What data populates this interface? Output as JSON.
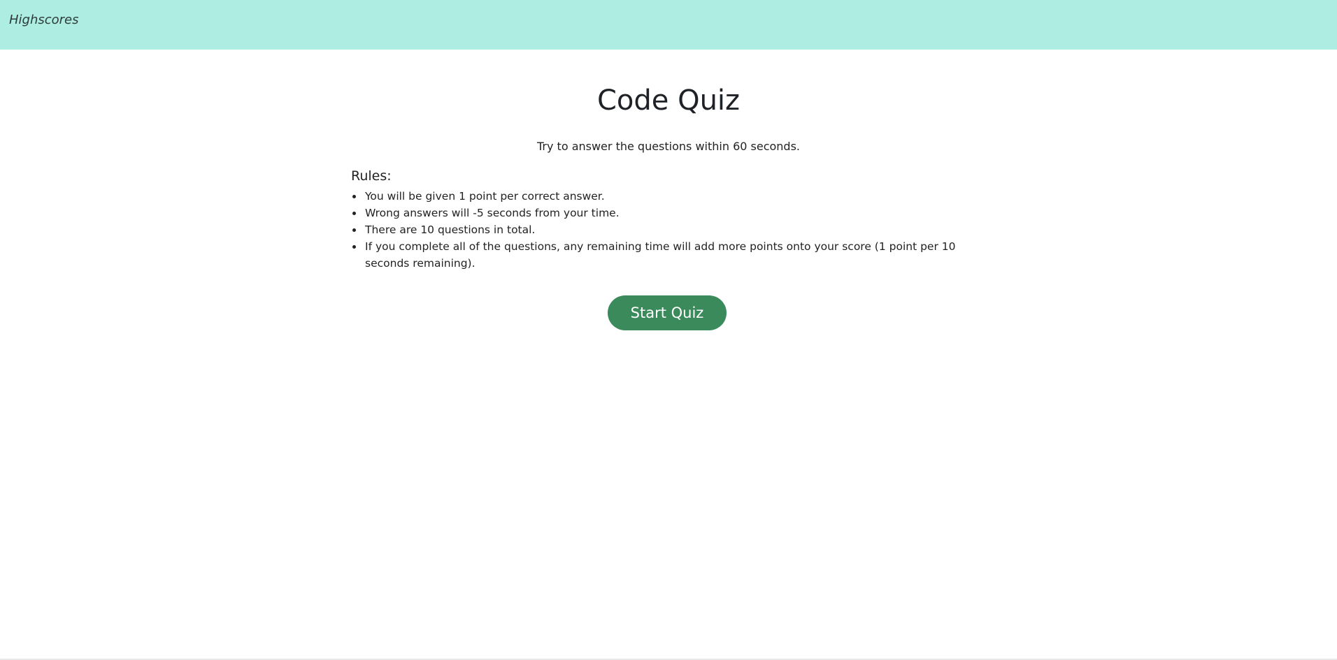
{
  "header": {
    "highscores_label": "Highscores"
  },
  "main": {
    "title": "Code Quiz",
    "subtitle": "Try to answer the questions within 60 seconds.",
    "rules_heading": "Rules:",
    "rules": [
      "You will be given 1 point per correct answer.",
      "Wrong answers will -5 seconds from your time.",
      "There are 10 questions in total.",
      "If you complete all of the questions, any remaining time will add more points onto your score (1 point per 10 seconds remaining)."
    ],
    "start_button_label": "Start Quiz"
  },
  "colors": {
    "header_bg": "#aeede2",
    "button_bg": "#3a8a5c",
    "button_text": "#ffffff"
  }
}
